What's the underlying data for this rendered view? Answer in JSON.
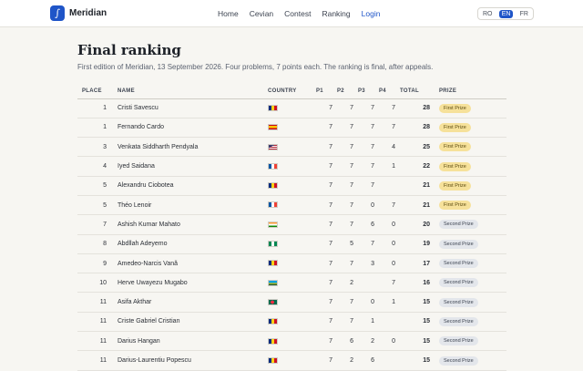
{
  "header": {
    "brand": "Meridian",
    "logo_glyph": "∫",
    "nav": [
      {
        "label": "Home",
        "active": false
      },
      {
        "label": "Cevian",
        "active": false
      },
      {
        "label": "Contest",
        "active": false
      },
      {
        "label": "Ranking",
        "active": false
      },
      {
        "label": "Login",
        "active": true
      }
    ],
    "languages": [
      {
        "code": "RO",
        "selected": false
      },
      {
        "code": "EN",
        "selected": true
      },
      {
        "code": "FR",
        "selected": false
      }
    ]
  },
  "page": {
    "title": "Final ranking",
    "subtitle": "First edition of Meridian, 13 September 2026. Four problems, 7 points each. The ranking is final, after appeals."
  },
  "table": {
    "columns": [
      "PLACE",
      "NAME",
      "COUNTRY",
      "P1",
      "P2",
      "P3",
      "P4",
      "TOTAL",
      "PRIZE"
    ],
    "rows": [
      {
        "place": "1",
        "name": "Cristi Savescu",
        "country": "ro",
        "p1": "7",
        "p2": "7",
        "p3": "7",
        "p4": "7",
        "total": "28",
        "prize": "First Prize",
        "prize_level": "first"
      },
      {
        "place": "1",
        "name": "Fernando Cardo",
        "country": "es",
        "p1": "7",
        "p2": "7",
        "p3": "7",
        "p4": "7",
        "total": "28",
        "prize": "First Prize",
        "prize_level": "first"
      },
      {
        "place": "3",
        "name": "Venkata Siddharth Pendyala",
        "country": "us",
        "p1": "7",
        "p2": "7",
        "p3": "7",
        "p4": "4",
        "total": "25",
        "prize": "First Prize",
        "prize_level": "first"
      },
      {
        "place": "4",
        "name": "Iyed Saidana",
        "country": "fr",
        "p1": "7",
        "p2": "7",
        "p3": "7",
        "p4": "1",
        "total": "22",
        "prize": "First Prize",
        "prize_level": "first"
      },
      {
        "place": "5",
        "name": "Alexandru Ciobotea",
        "country": "ro",
        "p1": "7",
        "p2": "7",
        "p3": "7",
        "p4": "",
        "total": "21",
        "prize": "First Prize",
        "prize_level": "first"
      },
      {
        "place": "5",
        "name": "Théo Lenoir",
        "country": "fr",
        "p1": "7",
        "p2": "7",
        "p3": "0",
        "p4": "7",
        "total": "21",
        "prize": "First Prize",
        "prize_level": "first"
      },
      {
        "place": "7",
        "name": "Ashish Kumar Mahato",
        "country": "in",
        "p1": "7",
        "p2": "7",
        "p3": "6",
        "p4": "0",
        "total": "20",
        "prize": "Second Prize",
        "prize_level": "second"
      },
      {
        "place": "8",
        "name": "Abdllah Adeyemo",
        "country": "ng",
        "p1": "7",
        "p2": "5",
        "p3": "7",
        "p4": "0",
        "total": "19",
        "prize": "Second Prize",
        "prize_level": "second"
      },
      {
        "place": "9",
        "name": "Amedeo-Narcis Vană",
        "country": "ro",
        "p1": "7",
        "p2": "7",
        "p3": "3",
        "p4": "0",
        "total": "17",
        "prize": "Second Prize",
        "prize_level": "second"
      },
      {
        "place": "10",
        "name": "Herve Uwayezu Mugabo",
        "country": "rw",
        "p1": "7",
        "p2": "2",
        "p3": "",
        "p4": "7",
        "total": "16",
        "prize": "Second Prize",
        "prize_level": "second"
      },
      {
        "place": "11",
        "name": "Asifa Akthar",
        "country": "bd",
        "p1": "7",
        "p2": "7",
        "p3": "0",
        "p4": "1",
        "total": "15",
        "prize": "Second Prize",
        "prize_level": "second"
      },
      {
        "place": "11",
        "name": "Criste Gabriel Cristian",
        "country": "ro",
        "p1": "7",
        "p2": "7",
        "p3": "1",
        "p4": "",
        "total": "15",
        "prize": "Second Prize",
        "prize_level": "second"
      },
      {
        "place": "11",
        "name": "Darius Hangan",
        "country": "ro",
        "p1": "7",
        "p2": "6",
        "p3": "2",
        "p4": "0",
        "total": "15",
        "prize": "Second Prize",
        "prize_level": "second"
      },
      {
        "place": "11",
        "name": "Darius-Laurentiu Popescu",
        "country": "ro",
        "p1": "7",
        "p2": "2",
        "p3": "6",
        "p4": "",
        "total": "15",
        "prize": "Second Prize",
        "prize_level": "second"
      }
    ]
  },
  "flag_colors": {
    "ro": [
      "#002b7f",
      "#fcd116",
      "#ce1126"
    ],
    "fr": [
      "#0055a4",
      "#ffffff",
      "#ef4135"
    ],
    "es": [
      "#c60b1e",
      "#ffc400",
      "#c60b1e"
    ],
    "in": [
      "#ff9933",
      "#ffffff",
      "#138808"
    ],
    "ng": [
      "#008751",
      "#ffffff",
      "#008751"
    ],
    "rw": [
      "#00a1de",
      "#fad201",
      "#20603d"
    ],
    "us": [
      "#b22234",
      "#ffffff",
      "#3c3b6e"
    ],
    "bd": [
      "#006a4e",
      "#f42a41"
    ]
  }
}
